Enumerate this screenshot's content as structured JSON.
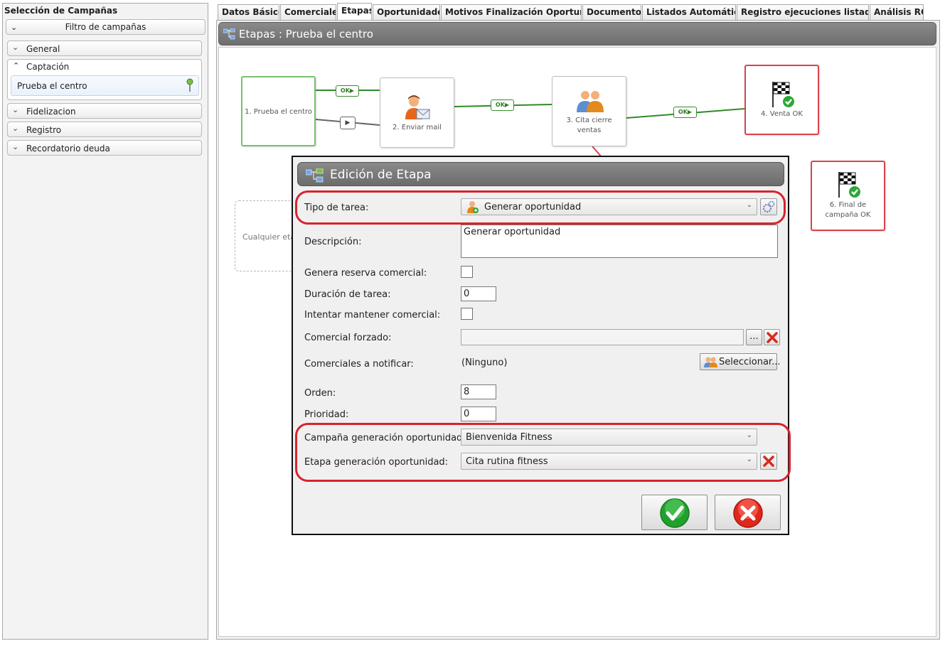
{
  "left_panel": {
    "title": "Selección de Campañas",
    "filter_label": "Filtro de campañas",
    "groups": [
      {
        "label": "General"
      },
      {
        "label": "Captación"
      },
      {
        "label": "Fidelizacion"
      },
      {
        "label": "Registro"
      },
      {
        "label": "Recordatorio deuda"
      }
    ],
    "selected_campaign": "Prueba el centro"
  },
  "tabs": [
    {
      "label": "Datos Básicos"
    },
    {
      "label": "Comerciales"
    },
    {
      "label": "Etapas"
    },
    {
      "label": "Oportunidades"
    },
    {
      "label": "Motivos Finalización Oportunid..."
    },
    {
      "label": "Documentos"
    },
    {
      "label": "Listados Automáticos"
    },
    {
      "label": "Registro ejecuciones listados ..."
    },
    {
      "label": "Análisis ROI"
    }
  ],
  "active_tab": "Etapas",
  "stages_panel": {
    "title": "Etapas : Prueba el centro",
    "nodes": [
      {
        "label": "1. Prueba el centro"
      },
      {
        "label": "2. Enviar mail"
      },
      {
        "label": "3. Cita cierre ventas"
      },
      {
        "label": "4. Venta OK"
      },
      {
        "label": "6. Final de campaña OK"
      },
      {
        "label": "Cualquier eta"
      }
    ],
    "connector_ok_label": "OK"
  },
  "dialog": {
    "title": "Edición de Etapa",
    "task_type_label": "Tipo de tarea:",
    "task_type_value": "Generar oportunidad",
    "description_label": "Descripción:",
    "description_value": "Generar oportunidad",
    "reserve_label": "Genera reserva comercial:",
    "duration_label": "Duración de tarea:",
    "duration_value": "0",
    "keep_commercial_label": "Intentar mantener comercial:",
    "forced_commercial_label": "Comercial forzado:",
    "forced_commercial_value": "",
    "forced_commercial_browse": "...",
    "notify_label": "Comerciales a notificar:",
    "notify_value": "(Ninguno)",
    "select_button": "Seleccionar...",
    "order_label": "Orden:",
    "order_value": "8",
    "priority_label": "Prioridad:",
    "priority_value": "0",
    "campaign_gen_label": "Campaña generación oportunidad:",
    "campaign_gen_value": "Bienvenida Fitness",
    "stage_gen_label": "Etapa generación oportunidad:",
    "stage_gen_value": "Cita rutina fitness"
  },
  "colors": {
    "accent_green": "#78c06f",
    "accent_red": "#d9434a",
    "highlight_red": "#d7232e",
    "header_gray": "#7a7a7a"
  }
}
